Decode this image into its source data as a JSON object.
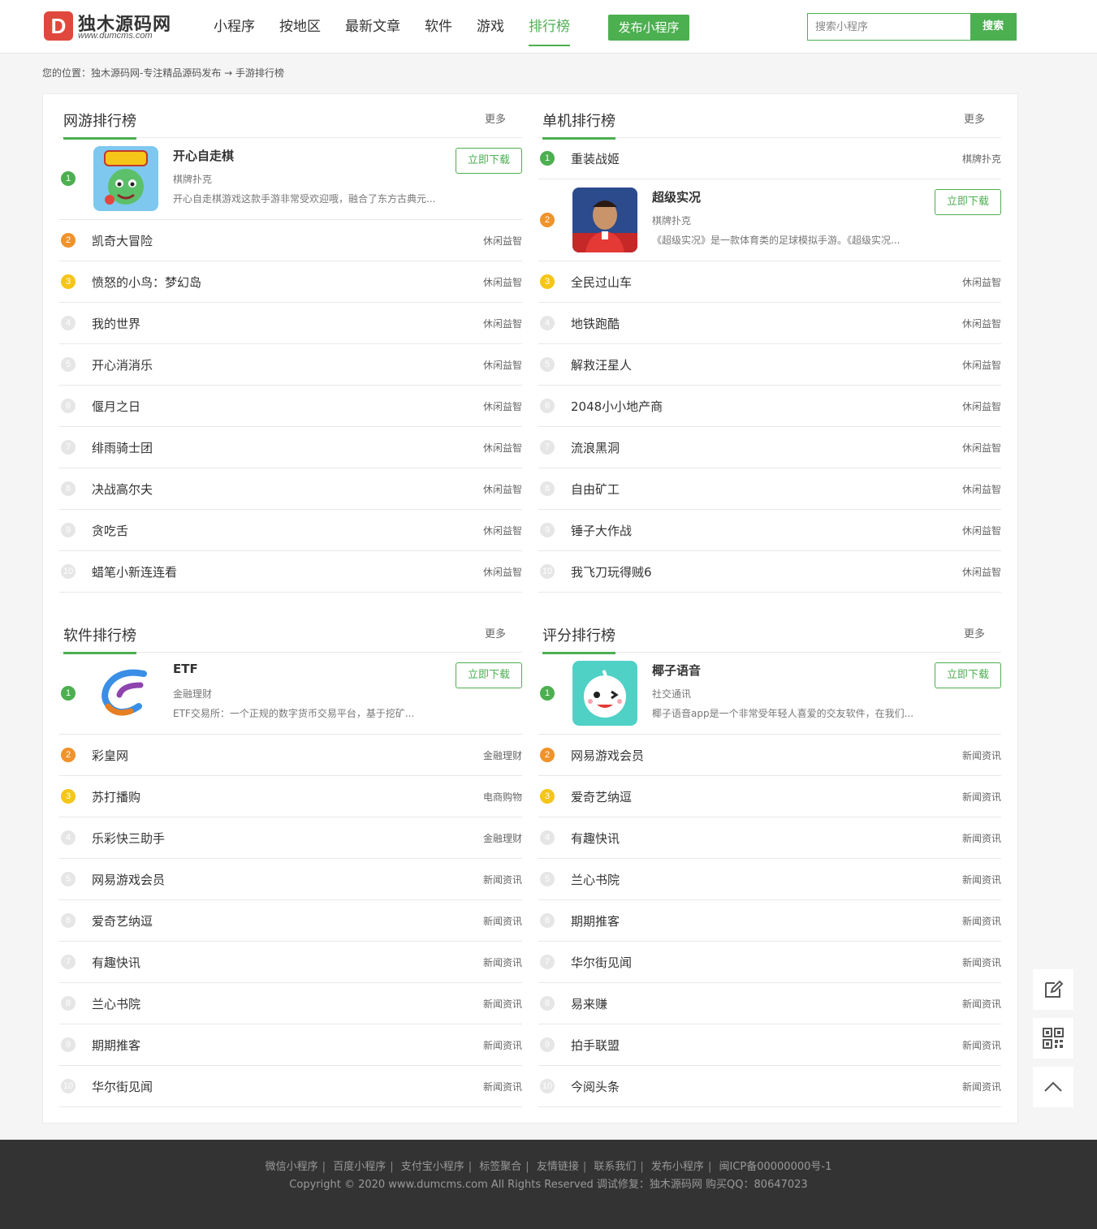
{
  "header": {
    "logo_text": "独木源码网",
    "logo_url": "www.dumcms.com",
    "logo_mark": "D",
    "nav": [
      {
        "label": "小程序",
        "active": false
      },
      {
        "label": "按地区",
        "active": false
      },
      {
        "label": "最新文章",
        "active": false
      },
      {
        "label": "软件",
        "active": false
      },
      {
        "label": "游戏",
        "active": false
      },
      {
        "label": "排行榜",
        "active": true
      }
    ],
    "publish_label": "发布小程序",
    "search_placeholder": "搜索小程序",
    "search_label": "搜索"
  },
  "breadcrumb": "您的位置：独木源码网-专注精品源码发布 → 手游排行榜",
  "colors": {
    "accent": "#4caf50",
    "rank2": "#f0932b",
    "rank3": "#f5c518",
    "footer": "#333333"
  },
  "boards": [
    {
      "title": "网游排行榜",
      "more": "更多",
      "top_index": 0,
      "top": {
        "title": "开心自走棋",
        "category": "棋牌扑克",
        "desc": "开心自走棋游戏这款手游非常受欢迎哦，融合了东方古典元...",
        "download": "立即下载",
        "icon": "game-chess-icon"
      },
      "items": [
        {
          "name": "开心自走棋",
          "cat": "棋牌扑克"
        },
        {
          "name": "凯奇大冒险",
          "cat": "休闲益智"
        },
        {
          "name": "愤怒的小鸟：梦幻岛",
          "cat": "休闲益智"
        },
        {
          "name": "我的世界",
          "cat": "休闲益智"
        },
        {
          "name": "开心消消乐",
          "cat": "休闲益智"
        },
        {
          "name": "偃月之日",
          "cat": "休闲益智"
        },
        {
          "name": "绯雨骑士团",
          "cat": "休闲益智"
        },
        {
          "name": "决战高尔夫",
          "cat": "休闲益智"
        },
        {
          "name": "贪吃舌",
          "cat": "休闲益智"
        },
        {
          "name": "蜡笔小新连连看",
          "cat": "休闲益智"
        }
      ]
    },
    {
      "title": "单机排行榜",
      "more": "更多",
      "top_index": 1,
      "top": {
        "title": "超级实况",
        "category": "棋牌扑克",
        "desc": "《超级实况》是一款体育类的足球模拟手游。《超级实况...",
        "download": "立即下载",
        "icon": "football-player-icon"
      },
      "items": [
        {
          "name": "重装战姬",
          "cat": "棋牌扑克"
        },
        {
          "name": "超级实况",
          "cat": "棋牌扑克"
        },
        {
          "name": "全民过山车",
          "cat": "休闲益智"
        },
        {
          "name": "地铁跑酷",
          "cat": "休闲益智"
        },
        {
          "name": "解救汪星人",
          "cat": "休闲益智"
        },
        {
          "name": "2048小小地产商",
          "cat": "休闲益智"
        },
        {
          "name": "流浪黑洞",
          "cat": "休闲益智"
        },
        {
          "name": "自由矿工",
          "cat": "休闲益智"
        },
        {
          "name": "锤子大作战",
          "cat": "休闲益智"
        },
        {
          "name": "我飞刀玩得贼6",
          "cat": "休闲益智"
        }
      ]
    },
    {
      "title": "软件排行榜",
      "more": "更多",
      "top_index": 0,
      "top": {
        "title": "ETF",
        "category": "金融理财",
        "desc": "ETF交易所：一个正规的数字货币交易平台，基于挖矿...",
        "download": "立即下载",
        "icon": "etf-logo-icon"
      },
      "items": [
        {
          "name": "ETF",
          "cat": "金融理财"
        },
        {
          "name": "彩皇网",
          "cat": "金融理财"
        },
        {
          "name": "苏打播购",
          "cat": "电商购物"
        },
        {
          "name": "乐彩快三助手",
          "cat": "金融理财"
        },
        {
          "name": "网易游戏会员",
          "cat": "新闻资讯"
        },
        {
          "name": "爱奇艺纳逗",
          "cat": "新闻资讯"
        },
        {
          "name": "有趣快讯",
          "cat": "新闻资讯"
        },
        {
          "name": "兰心书院",
          "cat": "新闻资讯"
        },
        {
          "name": "期期推客",
          "cat": "新闻资讯"
        },
        {
          "name": "华尔街见闻",
          "cat": "新闻资讯"
        }
      ]
    },
    {
      "title": "评分排行榜",
      "more": "更多",
      "top_index": 0,
      "top": {
        "title": "椰子语音",
        "category": "社交通讯",
        "desc": "椰子语音app是一个非常受年轻人喜爱的交友软件，在我们...",
        "download": "立即下载",
        "icon": "coconut-face-icon"
      },
      "items": [
        {
          "name": "椰子语音",
          "cat": "社交通讯"
        },
        {
          "name": "网易游戏会员",
          "cat": "新闻资讯"
        },
        {
          "name": "爱奇艺纳逗",
          "cat": "新闻资讯"
        },
        {
          "name": "有趣快讯",
          "cat": "新闻资讯"
        },
        {
          "name": "兰心书院",
          "cat": "新闻资讯"
        },
        {
          "name": "期期推客",
          "cat": "新闻资讯"
        },
        {
          "name": "华尔街见闻",
          "cat": "新闻资讯"
        },
        {
          "name": "易来赚",
          "cat": "新闻资讯"
        },
        {
          "name": "拍手联盟",
          "cat": "新闻资讯"
        },
        {
          "name": "今阅头条",
          "cat": "新闻资讯"
        }
      ]
    }
  ],
  "float_tools": [
    "edit-icon",
    "qrcode-icon",
    "back-to-top-icon"
  ],
  "footer": {
    "links": [
      "微信小程序",
      "百度小程序",
      "支付宝小程序",
      "标签聚合",
      "友情链接",
      "联系我们",
      "发布小程序",
      "闽ICP备00000000号-1"
    ],
    "copyright": "Copyright © 2020 www.dumcms.com All Rights Reserved 调试修复：独木源码网 购买QQ：80647023"
  }
}
